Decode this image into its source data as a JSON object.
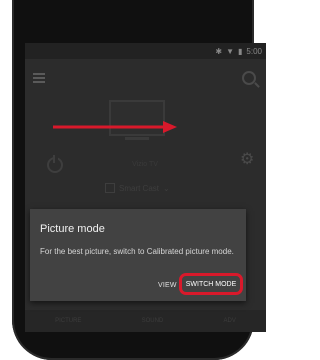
{
  "statusbar": {
    "time": "5:00"
  },
  "device": {
    "label": "Vizio TV"
  },
  "input": {
    "label": "Smart Cast"
  },
  "bottom_nav": {
    "items": [
      "PICTURE",
      "SOUND",
      "ADV"
    ]
  },
  "dialog": {
    "title": "Picture mode",
    "body": "For the best picture, switch to Calibrated picture mode.",
    "view_label": "VIEW",
    "switch_label": "SWITCH MODE"
  },
  "colors": {
    "highlight": "#d9192b",
    "dialog_bg": "#424242",
    "screen_bg": "#2c2c2c"
  }
}
